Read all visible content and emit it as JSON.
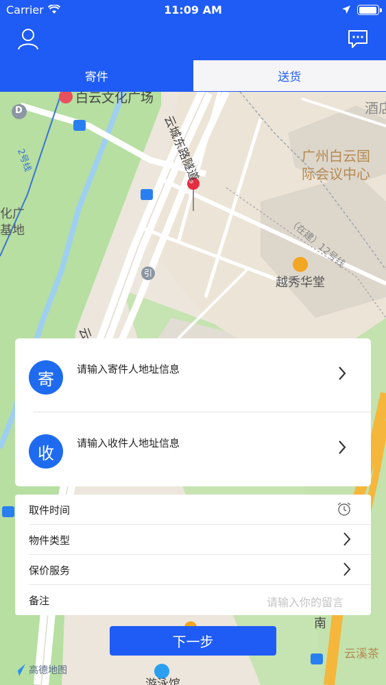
{
  "status_bar": {
    "carrier": "Carrier",
    "time": "11:09 AM"
  },
  "header": {
    "user_icon": "user-icon",
    "message_icon": "message-icon"
  },
  "tabs": [
    {
      "label": "寄件",
      "active": true
    },
    {
      "label": "送货",
      "active": false
    }
  ],
  "map": {
    "labels": {
      "plaza": "白云文化广场",
      "road": "云城东路隧道",
      "center_line1": "广州白云国",
      "center_line2": "际会议中心",
      "hotel": "酒店",
      "hall": "越秀华堂",
      "under_construction": "（在建）12号线",
      "line2": "2号线",
      "left_block1": "化广",
      "left_block2": "基地",
      "bottom_road": "云",
      "south": "南",
      "tea": "云溪茶",
      "park": "游泳馆",
      "marker_d": "D",
      "rail_sign": "引"
    },
    "logo": "高德地图"
  },
  "address": {
    "sender": {
      "badge": "寄",
      "placeholder": "请输入寄件人地址信息"
    },
    "receiver": {
      "badge": "收",
      "placeholder": "请输入收件人地址信息"
    }
  },
  "options": {
    "pickup_time": "取件时间",
    "item_type": "物件类型",
    "insurance": "保价服务",
    "remarks": "备注",
    "remarks_placeholder": "请输入你的留言"
  },
  "colors": {
    "primary": "#1f5bf5",
    "badge": "#1f6bf0"
  },
  "next_button": "下一步"
}
